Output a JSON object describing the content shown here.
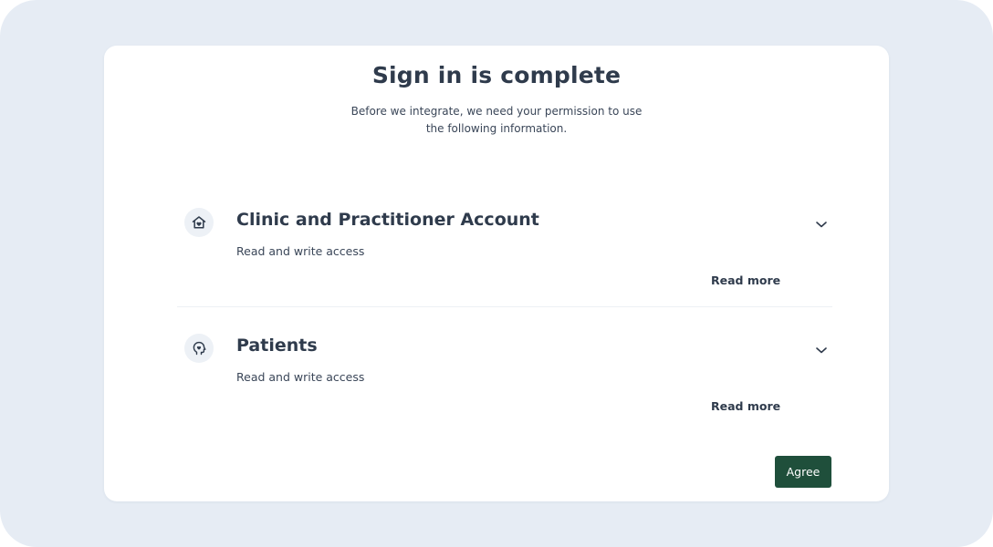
{
  "header": {
    "title": "Sign in is complete",
    "subtitle": "Before we integrate, we need your permission to use the following information."
  },
  "sections": [
    {
      "title": "Clinic and Practitioner Account",
      "access": "Read and write access",
      "read_more": "Read more",
      "icon": "home-heart-icon"
    },
    {
      "title": "Patients",
      "access": "Read and write access",
      "read_more": "Read more",
      "icon": "head-heart-icon"
    }
  ],
  "actions": {
    "agree_label": "Agree"
  },
  "colors": {
    "background": "#e6ecf4",
    "card": "#ffffff",
    "text": "#2f3b4c",
    "icon_bg": "#edf1f6",
    "primary_button": "#1f4f3b"
  }
}
